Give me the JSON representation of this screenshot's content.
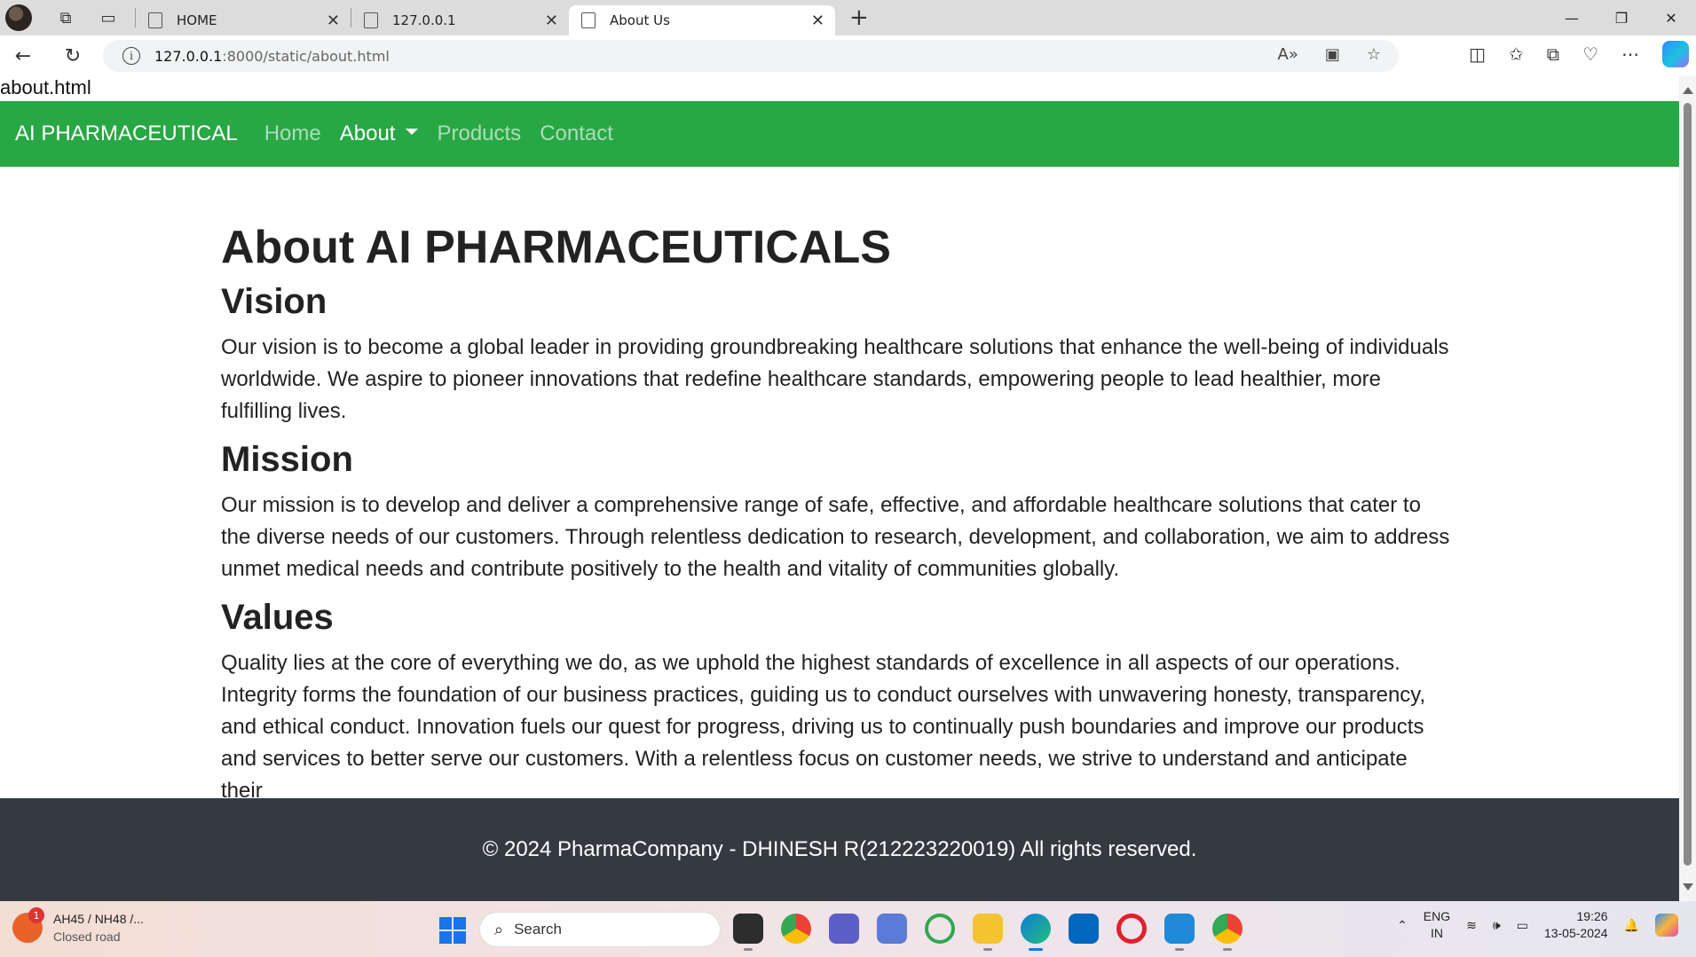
{
  "browser": {
    "tabs": [
      {
        "title": "HOME",
        "active": false
      },
      {
        "title": "127.0.0.1",
        "active": false
      },
      {
        "title": "About Us",
        "active": true
      }
    ],
    "url_host": "127.0.0.1",
    "url_path": ":8000/static/about.html"
  },
  "page": {
    "filename": "about.html",
    "navbar": {
      "brand": "AI PHARMACEUTICAL",
      "links": [
        "Home",
        "About",
        "Products",
        "Contact"
      ]
    },
    "heading": "About AI PHARMACEUTICALS",
    "sections": [
      {
        "title": "Vision",
        "text": "Our vision is to become a global leader in providing groundbreaking healthcare solutions that enhance the well-being of individuals worldwide. We aspire to pioneer innovations that redefine healthcare standards, empowering people to lead healthier, more fulfilling lives."
      },
      {
        "title": "Mission",
        "text": "Our mission is to develop and deliver a comprehensive range of safe, effective, and affordable healthcare solutions that cater to the diverse needs of our customers. Through relentless dedication to research, development, and collaboration, we aim to address unmet medical needs and contribute positively to the health and vitality of communities globally."
      },
      {
        "title": "Values",
        "text": "Quality lies at the core of everything we do, as we uphold the highest standards of excellence in all aspects of our operations. Integrity forms the foundation of our business practices, guiding us to conduct ourselves with unwavering honesty, transparency, and ethical conduct. Innovation fuels our quest for progress, driving us to continually push boundaries and improve our products and services to better serve our customers. With a relentless focus on customer needs, we strive to understand and anticipate their"
      }
    ],
    "footer": "© 2024 PharmaCompany - DHINESH R(212223220019) All rights reserved."
  },
  "taskbar": {
    "weather_badge": "1",
    "weather_title": "AH45 / NH48 /...",
    "weather_sub": "Closed road",
    "search_label": "Search",
    "lang_top": "ENG",
    "lang_bottom": "IN",
    "time": "19:26",
    "date": "13-05-2024"
  },
  "colors": {
    "navbar_bg": "#28a745",
    "footer_bg": "#343a40"
  }
}
